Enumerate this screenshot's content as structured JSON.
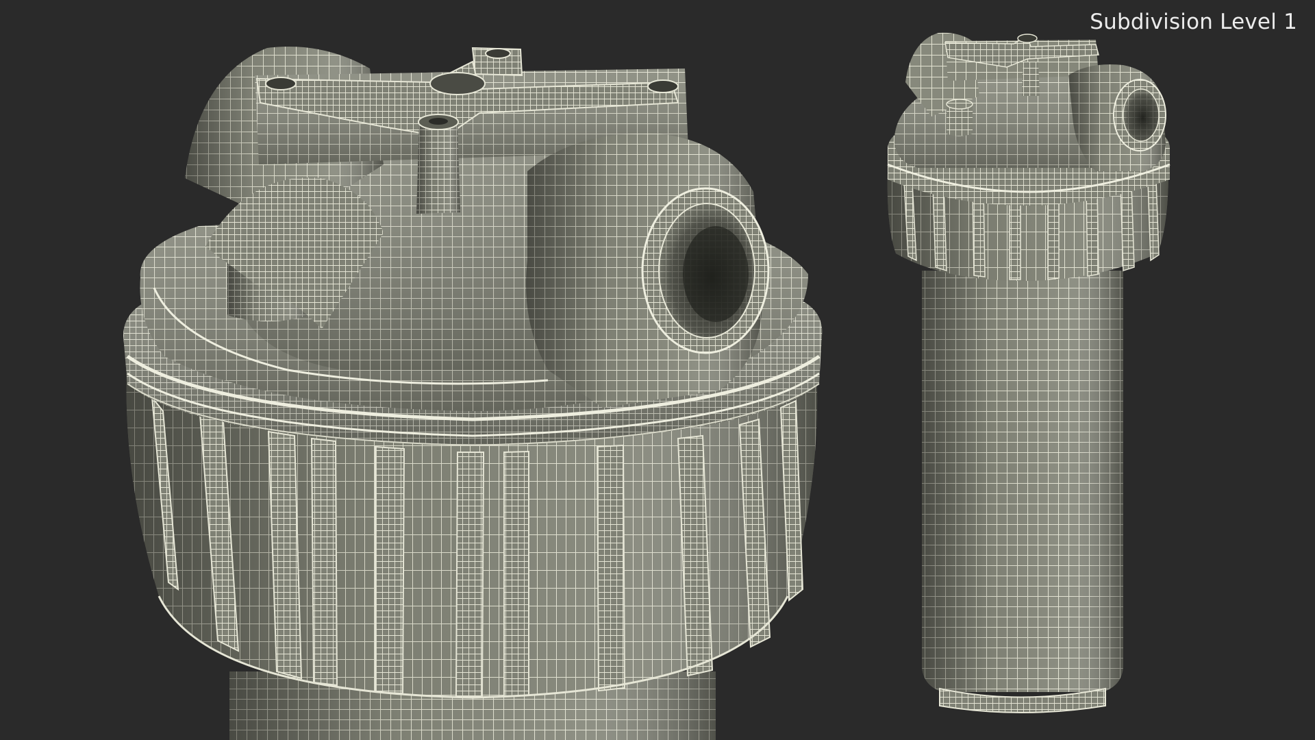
{
  "caption": {
    "label": "Subdivision Level 1"
  },
  "colors": {
    "background": "#2a2a2a",
    "surface": "#85877a",
    "wire": "#e6e6d6",
    "caption_text": "#ececec"
  }
}
